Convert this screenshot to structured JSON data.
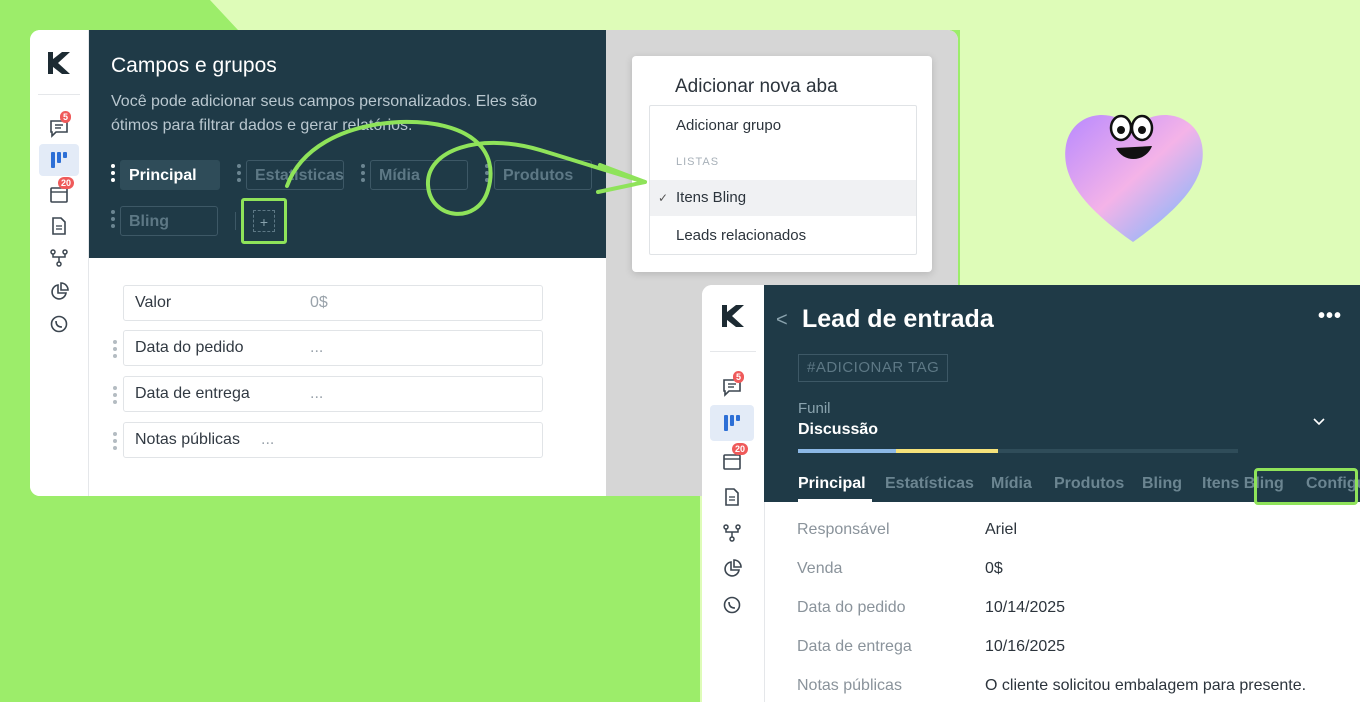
{
  "colors": {
    "accent_green": "#8fe35a",
    "dark_header": "#1f3a47",
    "badge_red": "#ef5a5a"
  },
  "sidebar": {
    "logo": "k-logo-icon",
    "items": [
      {
        "icon": "chat-icon",
        "badge": "5"
      },
      {
        "icon": "kanban-icon",
        "badge": ""
      },
      {
        "icon": "calendar-icon",
        "badge": "20"
      },
      {
        "icon": "document-icon",
        "badge": ""
      },
      {
        "icon": "flow-icon",
        "badge": ""
      },
      {
        "icon": "pie-chart-icon",
        "badge": ""
      },
      {
        "icon": "whatsapp-icon",
        "badge": ""
      }
    ]
  },
  "fields_panel": {
    "title": "Campos e grupos",
    "description": "Você pode adicionar seus campos personalizados. Eles são ótimos para filtrar dados e gerar relatórios.",
    "tabs": [
      "Principal",
      "Estatísticas",
      "Mídia",
      "Produtos",
      "Bling"
    ],
    "add_tab_label": "+",
    "fields": [
      {
        "label": "Valor",
        "value": "0$"
      },
      {
        "label": "Data do pedido",
        "value": "..."
      },
      {
        "label": "Data de entrega",
        "value": "..."
      },
      {
        "label": "Notas públicas",
        "value": "..."
      }
    ]
  },
  "dropdown": {
    "title": "Adicionar nova aba",
    "add_group": "Adicionar grupo",
    "section": "LISTAS",
    "lists": [
      "Itens Bling",
      "Leads relacionados"
    ],
    "selected": "Itens Bling"
  },
  "lead": {
    "title": "Lead de entrada",
    "back": "<",
    "more": "•••",
    "tag_placeholder": "#ADICIONAR TAG",
    "funnel_label": "Funil",
    "funnel_value": "Discussão",
    "tabs": [
      "Principal",
      "Estatísticas",
      "Mídia",
      "Produtos",
      "Bling",
      "Itens Bling",
      "Configu"
    ],
    "details": [
      {
        "label": "Responsável",
        "value": "Ariel"
      },
      {
        "label": "Venda",
        "value": "0$"
      },
      {
        "label": "Data do pedido",
        "value": "10/14/2025"
      },
      {
        "label": "Data de entrega",
        "value": "10/16/2025"
      },
      {
        "label": "Notas públicas",
        "value": "O cliente solicitou embalagem para presente."
      }
    ]
  }
}
